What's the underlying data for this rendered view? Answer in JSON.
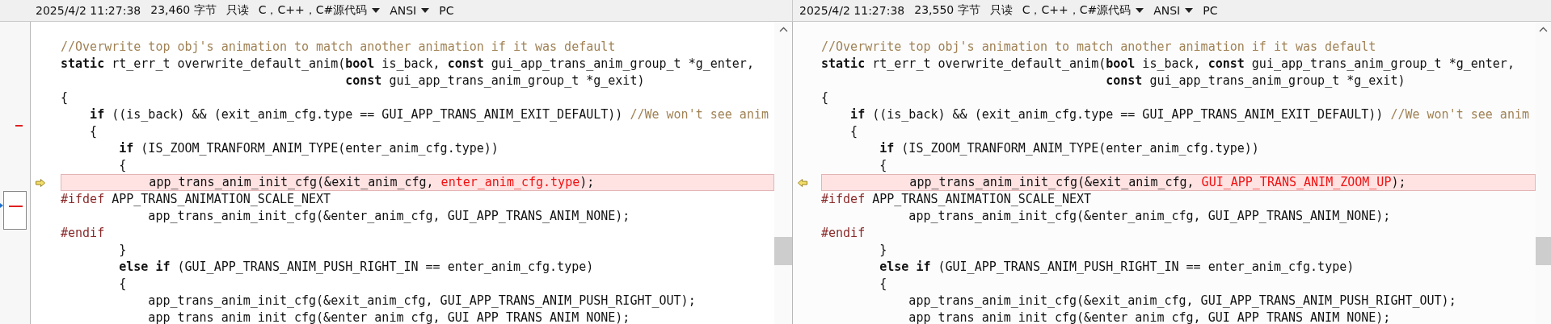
{
  "panes": [
    {
      "status": {
        "timestamp": "2025/4/2 11:27:38",
        "size": "23,460 字节",
        "mode": "只读",
        "language": "C，C++，C#源代码",
        "encoding": "ANSI",
        "line_ending": "PC"
      },
      "lines": [
        {
          "changed": false
        },
        {
          "changed": false,
          "segments": [
            {
              "kind": "comment",
              "text": "//Overwrite top obj's animation to match another animation if it was default"
            }
          ]
        },
        {
          "changed": false,
          "segments": [
            {
              "kind": "keyword",
              "text": "static"
            },
            {
              "kind": "text",
              "text": " rt_err_t overwrite_default_anim("
            },
            {
              "kind": "keyword",
              "text": "bool"
            },
            {
              "kind": "text",
              "text": " is_back, "
            },
            {
              "kind": "keyword",
              "text": "const"
            },
            {
              "kind": "text",
              "text": " gui_app_trans_anim_group_t *g_enter,"
            }
          ]
        },
        {
          "changed": false,
          "segments": [
            {
              "kind": "keyword",
              "text": "                                       const"
            },
            {
              "kind": "text",
              "text": " gui_app_trans_anim_group_t *g_exit)"
            }
          ]
        },
        {
          "changed": false,
          "segments": [
            {
              "kind": "text",
              "text": "{"
            }
          ]
        },
        {
          "changed": false,
          "segments": [
            {
              "kind": "keyword",
              "text": "    if"
            },
            {
              "kind": "text",
              "text": " ((is_back) && (exit_anim_cfg.type == GUI_APP_TRANS_ANIM_EXIT_DEFAULT)) "
            },
            {
              "kind": "comment",
              "text": "//We won't see anim"
            }
          ]
        },
        {
          "changed": false,
          "segments": [
            {
              "kind": "text",
              "text": "    {"
            }
          ]
        },
        {
          "changed": false,
          "segments": [
            {
              "kind": "keyword",
              "text": "        if"
            },
            {
              "kind": "text",
              "text": " (IS_ZOOM_TRANFORM_ANIM_TYPE(enter_anim_cfg.type))"
            }
          ]
        },
        {
          "changed": false,
          "segments": [
            {
              "kind": "text",
              "text": "        {"
            }
          ]
        },
        {
          "changed": true,
          "segments": [
            {
              "kind": "text",
              "text": "            app_trans_anim_init_cfg(&exit_anim_cfg, "
            },
            {
              "kind": "changed",
              "text": "enter_anim_cfg.type"
            },
            {
              "kind": "text",
              "text": ");"
            }
          ]
        },
        {
          "changed": false,
          "segments": [
            {
              "kind": "preproc",
              "text": "#ifdef"
            },
            {
              "kind": "text",
              "text": " APP_TRANS_ANIMATION_SCALE_NEXT"
            }
          ]
        },
        {
          "changed": false,
          "segments": [
            {
              "kind": "text",
              "text": "            app_trans_anim_init_cfg(&enter_anim_cfg, GUI_APP_TRANS_ANIM_NONE);"
            }
          ]
        },
        {
          "changed": false,
          "segments": [
            {
              "kind": "preproc",
              "text": "#endif"
            }
          ]
        },
        {
          "changed": false,
          "segments": [
            {
              "kind": "text",
              "text": "        }"
            }
          ]
        },
        {
          "changed": false,
          "segments": [
            {
              "kind": "keyword",
              "text": "        else if"
            },
            {
              "kind": "text",
              "text": " (GUI_APP_TRANS_ANIM_PUSH_RIGHT_IN == enter_anim_cfg.type)"
            }
          ]
        },
        {
          "changed": false,
          "segments": [
            {
              "kind": "text",
              "text": "        {"
            }
          ]
        },
        {
          "changed": false,
          "segments": [
            {
              "kind": "text",
              "text": "            app_trans_anim_init_cfg(&exit_anim_cfg, GUI_APP_TRANS_ANIM_PUSH_RIGHT_OUT);"
            }
          ]
        },
        {
          "changed": false,
          "segments": [
            {
              "kind": "text",
              "text": "            app_trans_anim_init_cfg(&enter_anim_cfg, GUI_APP_TRANS_ANIM_NONE);"
            }
          ]
        }
      ]
    },
    {
      "status": {
        "timestamp": "2025/4/2 11:27:38",
        "size": "23,550 字节",
        "mode": "只读",
        "language": "C，C++，C#源代码",
        "encoding": "ANSI",
        "line_ending": "PC"
      },
      "lines": [
        {
          "changed": false
        },
        {
          "changed": false,
          "segments": [
            {
              "kind": "comment",
              "text": "//Overwrite top obj's animation to match another animation if it was default"
            }
          ]
        },
        {
          "changed": false,
          "segments": [
            {
              "kind": "keyword",
              "text": "static"
            },
            {
              "kind": "text",
              "text": " rt_err_t overwrite_default_anim("
            },
            {
              "kind": "keyword",
              "text": "bool"
            },
            {
              "kind": "text",
              "text": " is_back, "
            },
            {
              "kind": "keyword",
              "text": "const"
            },
            {
              "kind": "text",
              "text": " gui_app_trans_anim_group_t *g_enter,"
            }
          ]
        },
        {
          "changed": false,
          "segments": [
            {
              "kind": "keyword",
              "text": "                                       const"
            },
            {
              "kind": "text",
              "text": " gui_app_trans_anim_group_t *g_exit)"
            }
          ]
        },
        {
          "changed": false,
          "segments": [
            {
              "kind": "text",
              "text": "{"
            }
          ]
        },
        {
          "changed": false,
          "segments": [
            {
              "kind": "keyword",
              "text": "    if"
            },
            {
              "kind": "text",
              "text": " ((is_back) && (exit_anim_cfg.type == GUI_APP_TRANS_ANIM_EXIT_DEFAULT)) "
            },
            {
              "kind": "comment",
              "text": "//We won't see anim"
            }
          ]
        },
        {
          "changed": false,
          "segments": [
            {
              "kind": "text",
              "text": "    {"
            }
          ]
        },
        {
          "changed": false,
          "segments": [
            {
              "kind": "keyword",
              "text": "        if"
            },
            {
              "kind": "text",
              "text": " (IS_ZOOM_TRANFORM_ANIM_TYPE(enter_anim_cfg.type))"
            }
          ]
        },
        {
          "changed": false,
          "segments": [
            {
              "kind": "text",
              "text": "        {"
            }
          ]
        },
        {
          "changed": true,
          "segments": [
            {
              "kind": "text",
              "text": "            app_trans_anim_init_cfg(&exit_anim_cfg, "
            },
            {
              "kind": "changed",
              "text": "GUI_APP_TRANS_ANIM_ZOOM_UP"
            },
            {
              "kind": "text",
              "text": ");"
            }
          ]
        },
        {
          "changed": false,
          "segments": [
            {
              "kind": "preproc",
              "text": "#ifdef"
            },
            {
              "kind": "text",
              "text": " APP_TRANS_ANIMATION_SCALE_NEXT"
            }
          ]
        },
        {
          "changed": false,
          "segments": [
            {
              "kind": "text",
              "text": "            app_trans_anim_init_cfg(&enter_anim_cfg, GUI_APP_TRANS_ANIM_NONE);"
            }
          ]
        },
        {
          "changed": false,
          "segments": [
            {
              "kind": "preproc",
              "text": "#endif"
            }
          ]
        },
        {
          "changed": false,
          "segments": [
            {
              "kind": "text",
              "text": "        }"
            }
          ]
        },
        {
          "changed": false,
          "segments": [
            {
              "kind": "keyword",
              "text": "        else if"
            },
            {
              "kind": "text",
              "text": " (GUI_APP_TRANS_ANIM_PUSH_RIGHT_IN == enter_anim_cfg.type)"
            }
          ]
        },
        {
          "changed": false,
          "segments": [
            {
              "kind": "text",
              "text": "        {"
            }
          ]
        },
        {
          "changed": false,
          "segments": [
            {
              "kind": "text",
              "text": "            app_trans_anim_init_cfg(&exit_anim_cfg, GUI_APP_TRANS_ANIM_PUSH_RIGHT_OUT);"
            }
          ]
        },
        {
          "changed": false,
          "segments": [
            {
              "kind": "text",
              "text": "            app_trans_anim_init_cfg(&enter_anim_cfg, GUI_APP_TRANS_ANIM_NONE);"
            }
          ]
        }
      ]
    }
  ]
}
